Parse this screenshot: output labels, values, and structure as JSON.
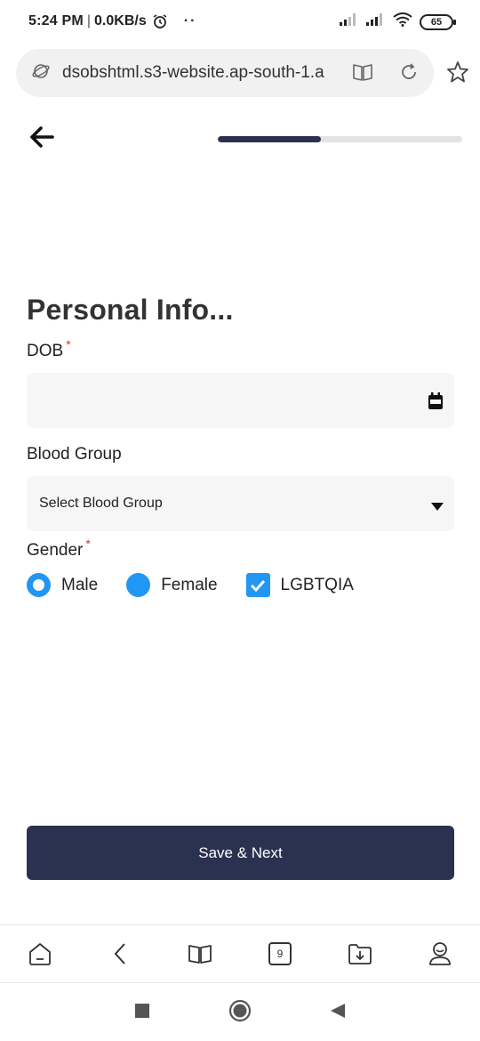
{
  "status_bar": {
    "time": "5:24 PM",
    "separator": "|",
    "speed": "0.0KB/s",
    "dots": "··",
    "battery": "65"
  },
  "browser": {
    "url": "dsobshtml.s3-website.ap-south-1.a"
  },
  "progress": {
    "fraction": 0.42
  },
  "form": {
    "title": "Personal Info...",
    "dob_label": "DOB",
    "required_mark": "*",
    "dob_value": "",
    "blood_group_label": "Blood Group",
    "blood_group_placeholder": "Select Blood Group",
    "gender_label": "Gender",
    "gender_options": [
      {
        "label": "Male",
        "type": "radio",
        "checked": true
      },
      {
        "label": "Female",
        "type": "radio",
        "checked": false
      },
      {
        "label": "LGBTQIA",
        "type": "checkbox",
        "checked": true
      }
    ]
  },
  "actions": {
    "save_next": "Save & Next"
  },
  "browser_nav": {
    "tab_count": "9"
  },
  "colors": {
    "primary": "#2b3150",
    "accent": "#2196f3",
    "required": "#e0302a",
    "field_bg": "#f6f6f6"
  }
}
